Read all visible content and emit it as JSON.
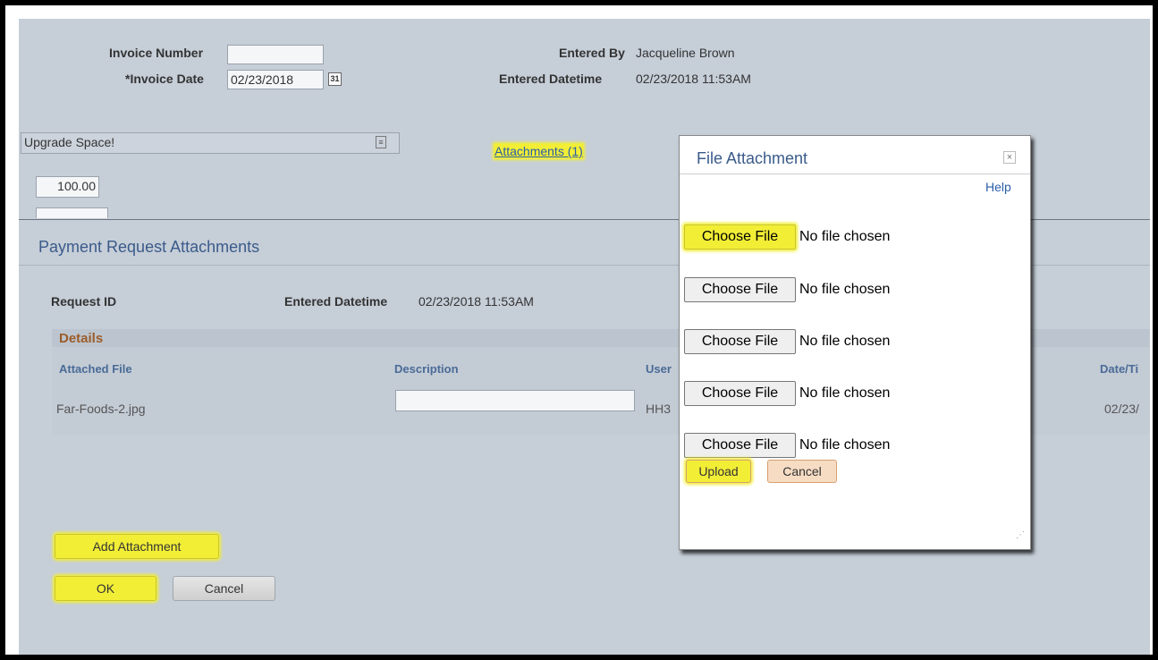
{
  "invoice": {
    "number_label": "Invoice Number",
    "number_value": "",
    "date_label": "*Invoice Date",
    "date_value": "02/23/2018",
    "calendar_icon_glyph": "31",
    "entered_by_label": "Entered By",
    "entered_by_value": "Jacqueline Brown",
    "entered_datetime_label": "Entered Datetime",
    "entered_datetime_value": "02/23/2018 11:53AM",
    "description_value": "Upgrade Space!",
    "amount_value": "100.00",
    "attachments_link": "Attachments (1)"
  },
  "attachments_page": {
    "title": "Payment Request Attachments",
    "request_id_label": "Request ID",
    "entered_datetime_label": "Entered Datetime",
    "entered_datetime_value": "02/23/2018 11:53AM",
    "details_title": "Details",
    "columns": {
      "attached_file": "Attached File",
      "description": "Description",
      "user": "User",
      "datetime": "Date/Ti"
    },
    "rows": [
      {
        "file": "Far-Foods-2.jpg",
        "description": "",
        "user": "HH3",
        "datetime": "02/23/"
      }
    ],
    "add_attachment_label": "Add Attachment",
    "ok_label": "OK",
    "cancel_label": "Cancel"
  },
  "dialog": {
    "title": "File Attachment",
    "close_glyph": "×",
    "help_label": "Help",
    "file_inputs": [
      {
        "button": "Choose File",
        "status": "No file chosen"
      },
      {
        "button": "Choose File",
        "status": "No file chosen"
      },
      {
        "button": "Choose File",
        "status": "No file chosen"
      },
      {
        "button": "Choose File",
        "status": "No file chosen"
      },
      {
        "button": "Choose File",
        "status": "No file chosen"
      }
    ],
    "upload_label": "Upload",
    "cancel_label": "Cancel"
  },
  "colors": {
    "highlight": "#f2ee36",
    "page_bg": "#c6ced8",
    "title_blue": "#3b5b8a",
    "details_brown": "#9c5d2b",
    "column_header_blue": "#4a6b97"
  }
}
